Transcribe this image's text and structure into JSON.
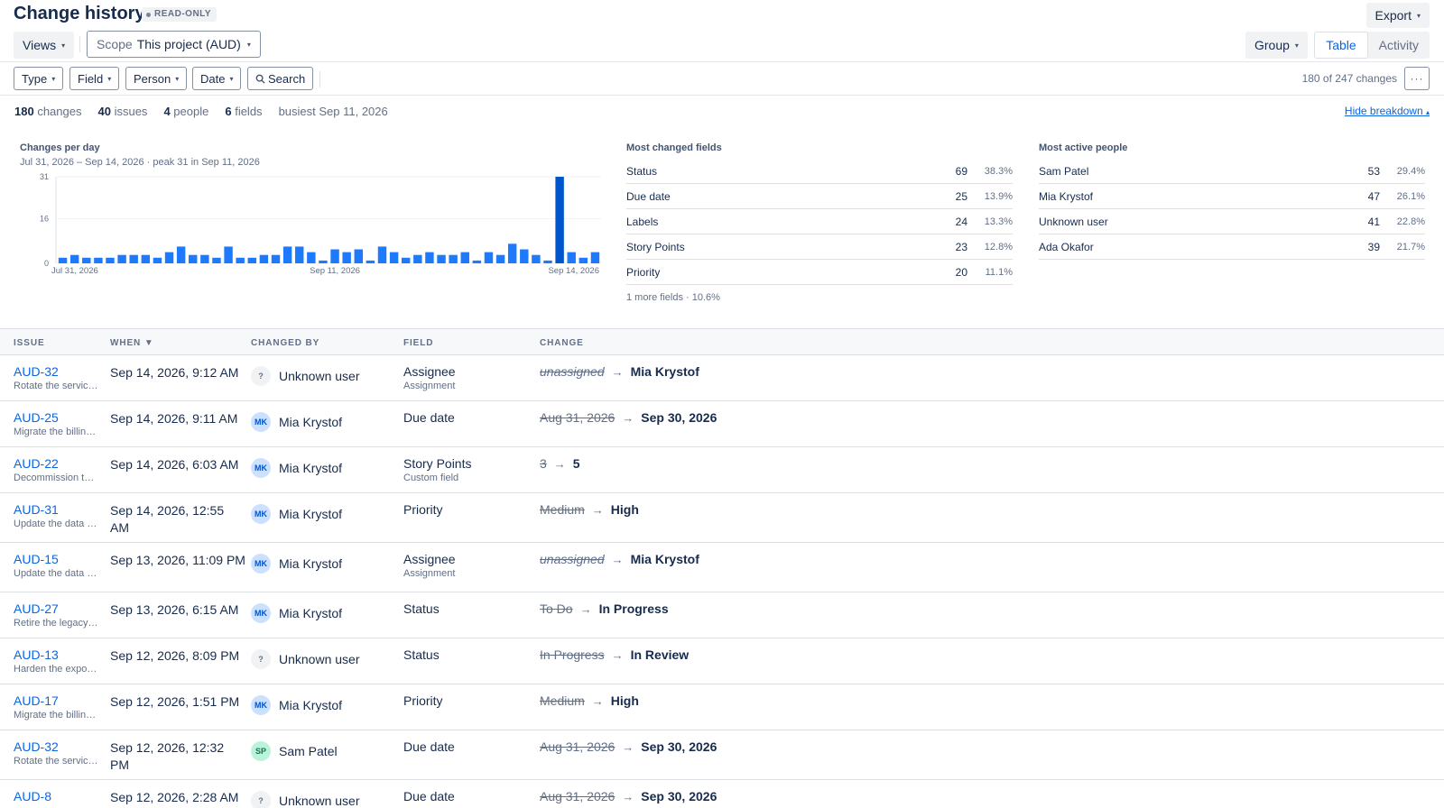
{
  "header": {
    "title": "Change history",
    "badge": "READ-ONLY",
    "export_label": "Export"
  },
  "toolbar": {
    "views_label": "Views",
    "scope_label": "Scope",
    "scope_value": "This project (AUD)",
    "group_label": "Group",
    "view_tabs": [
      "Table",
      "Activity"
    ],
    "active_view": "Table"
  },
  "filters": {
    "type_label": "Type",
    "field_label": "Field",
    "person_label": "Person",
    "date_label": "Date",
    "search_label": "Search",
    "count_text": "180 of 247 changes",
    "more_label": "···"
  },
  "stats": {
    "changes_num": "180",
    "changes_label": "changes",
    "issues_num": "40",
    "issues_label": "issues",
    "people_num": "4",
    "people_label": "people",
    "fields_num": "6",
    "fields_label": "fields",
    "busiest": "busiest Sep 11, 2026",
    "hide_label": "Hide breakdown"
  },
  "chart_data": {
    "type": "bar",
    "title": "Changes per day",
    "subtitle": "Jul 31, 2026 – Sep 14, 2026 · peak 31 in Sep 11, 2026",
    "y_ticks": [
      "31",
      "16",
      "0"
    ],
    "x_ticks": [
      "Jul 31, 2026",
      "Sep 11, 2026",
      "Sep 14, 2026"
    ],
    "ylim": [
      0,
      31
    ],
    "values": [
      2,
      3,
      2,
      2,
      2,
      3,
      3,
      3,
      2,
      4,
      6,
      3,
      3,
      2,
      6,
      2,
      2,
      3,
      3,
      6,
      6,
      4,
      1,
      5,
      4,
      5,
      1,
      6,
      4,
      2,
      3,
      4,
      3,
      3,
      4,
      1,
      4,
      3,
      7,
      5,
      3,
      1,
      31,
      4,
      2,
      4
    ],
    "color": "#1d7afc",
    "peak_color": "#0055cc"
  },
  "fields_panel": {
    "title": "Most changed fields",
    "items": [
      {
        "name": "Status",
        "count": "69",
        "pct": "38.3%"
      },
      {
        "name": "Due date",
        "count": "25",
        "pct": "13.9%"
      },
      {
        "name": "Labels",
        "count": "24",
        "pct": "13.3%"
      },
      {
        "name": "Story Points",
        "count": "23",
        "pct": "12.8%"
      },
      {
        "name": "Priority",
        "count": "20",
        "pct": "11.1%"
      }
    ],
    "footer": "1 more fields · 10.6%"
  },
  "people_panel": {
    "title": "Most active people",
    "items": [
      {
        "name": "Sam Patel",
        "count": "53",
        "pct": "29.4%"
      },
      {
        "name": "Mia Krystof",
        "count": "47",
        "pct": "26.1%"
      },
      {
        "name": "Unknown user",
        "count": "41",
        "pct": "22.8%"
      },
      {
        "name": "Ada Okafor",
        "count": "39",
        "pct": "21.7%"
      }
    ]
  },
  "table": {
    "columns": [
      "ISSUE",
      "WHEN ▼",
      "CHANGED BY",
      "FIELD",
      "CHANGE"
    ],
    "rows": [
      {
        "key": "AUD-32",
        "summary": "Rotate the service credentials",
        "when": "Sep 14, 2026, 9:12 AM",
        "initials": "?",
        "by": "Unknown user",
        "field": "Assignee",
        "field_sub": "Assignment",
        "old": "unassigned",
        "new": "Mia Krystof"
      },
      {
        "key": "AUD-25",
        "summary": "Migrate the billing export",
        "when": "Sep 14, 2026, 9:11 AM",
        "initials": "MK",
        "by": "Mia Krystof",
        "field": "Due date",
        "field_sub": "",
        "old": "Aug 31, 2026",
        "new": "Sep 30, 2026"
      },
      {
        "key": "AUD-22",
        "summary": "Decommission the old gateway",
        "when": "Sep 14, 2026, 6:03 AM",
        "initials": "MK",
        "by": "Mia Krystof",
        "field": "Story Points",
        "field_sub": "Custom field",
        "old": "3",
        "new": "5"
      },
      {
        "key": "AUD-31",
        "summary": "Update the data retention policy",
        "when": "Sep 14, 2026, 12:55 AM",
        "initials": "MK",
        "by": "Mia Krystof",
        "field": "Priority",
        "field_sub": "",
        "old": "Medium",
        "new": "High"
      },
      {
        "key": "AUD-15",
        "summary": "Update the data retention policy",
        "when": "Sep 13, 2026, 11:09 PM",
        "initials": "MK",
        "by": "Mia Krystof",
        "field": "Assignee",
        "field_sub": "Assignment",
        "old": "unassigned",
        "new": "Mia Krystof"
      },
      {
        "key": "AUD-27",
        "summary": "Retire the legacy endpoints",
        "when": "Sep 13, 2026, 6:15 AM",
        "initials": "MK",
        "by": "Mia Krystof",
        "field": "Status",
        "field_sub": "",
        "old": "To Do",
        "new": "In Progress"
      },
      {
        "key": "AUD-13",
        "summary": "Harden the export pipeline",
        "when": "Sep 12, 2026, 8:09 PM",
        "initials": "?",
        "by": "Unknown user",
        "field": "Status",
        "field_sub": "",
        "old": "In Progress",
        "new": "In Review"
      },
      {
        "key": "AUD-17",
        "summary": "Migrate the billing export",
        "when": "Sep 12, 2026, 1:51 PM",
        "initials": "MK",
        "by": "Mia Krystof",
        "field": "Priority",
        "field_sub": "",
        "old": "Medium",
        "new": "High"
      },
      {
        "key": "AUD-32",
        "summary": "Rotate the service credentials",
        "when": "Sep 12, 2026, 12:32 PM",
        "initials": "SP",
        "by": "Sam Patel",
        "field": "Due date",
        "field_sub": "",
        "old": "Aug 31, 2026",
        "new": "Sep 30, 2026"
      },
      {
        "key": "AUD-8",
        "summary": "",
        "when": "Sep 12, 2026, 2:28 AM",
        "initials": "?",
        "by": "Unknown user",
        "field": "Due date",
        "field_sub": "",
        "old": "Aug 31, 2026",
        "new": "Sep 30, 2026"
      }
    ]
  }
}
